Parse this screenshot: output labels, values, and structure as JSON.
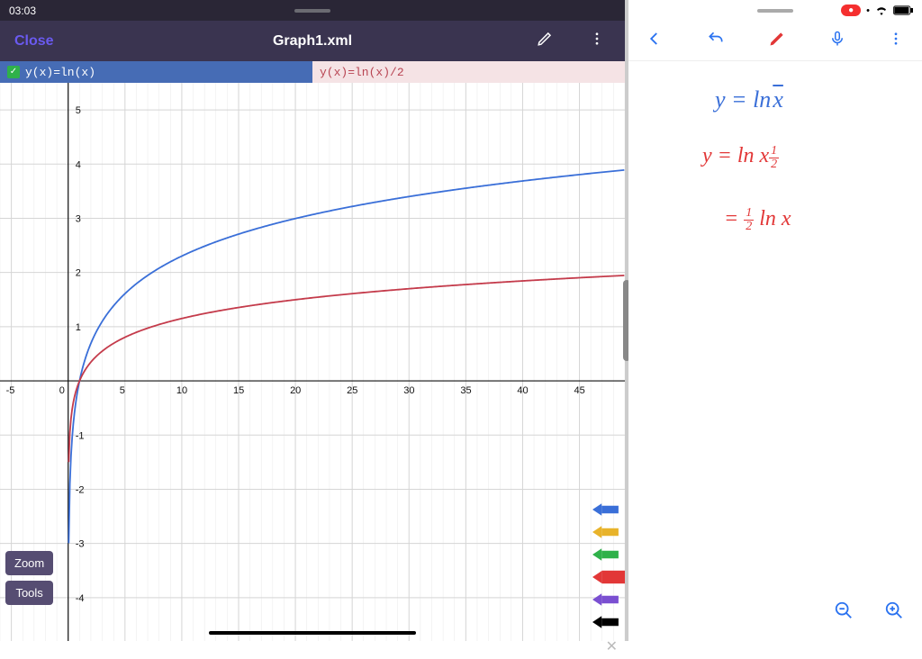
{
  "status": {
    "time": "03:03",
    "wifi": "wifi",
    "battery": "battery"
  },
  "titlebar": {
    "close_label": "Close",
    "title": "Graph1.xml"
  },
  "equations": {
    "tab1": "y(x)=ln(x)",
    "tab2": "y(x)=ln(x)/2"
  },
  "buttons": {
    "zoom": "Zoom",
    "tools": "Tools"
  },
  "pen_colors": [
    "#3a6fd8",
    "#e8b32a",
    "#2fb14a",
    "#e23737",
    "#7a4fd1",
    "#000000"
  ],
  "notes": {
    "line1_pre": "y = ln",
    "line1_sqrt": "x",
    "line2_pre": "y = ln x",
    "line2_exp_num": "1",
    "line2_exp_den": "2",
    "line3_pre": "= ",
    "line3_num": "1",
    "line3_den": "2",
    "line3_post": " ln x"
  },
  "right_status": {
    "rec": "●"
  },
  "chart_data": {
    "type": "line",
    "xlabel": "",
    "ylabel": "",
    "xlim": [
      -6,
      49
    ],
    "ylim": [
      -4.8,
      5.5
    ],
    "xticks": [
      -5,
      0,
      5,
      10,
      15,
      20,
      25,
      30,
      35,
      40,
      45
    ],
    "yticks": [
      -4,
      -3,
      -2,
      -1,
      1,
      2,
      3,
      4,
      5
    ],
    "series": [
      {
        "name": "y=ln(x)",
        "color": "#3a6fd8",
        "expression": "ln(x)"
      },
      {
        "name": "y=ln(x)/2",
        "color": "#c43b4b",
        "expression": "ln(x)/2"
      }
    ]
  }
}
